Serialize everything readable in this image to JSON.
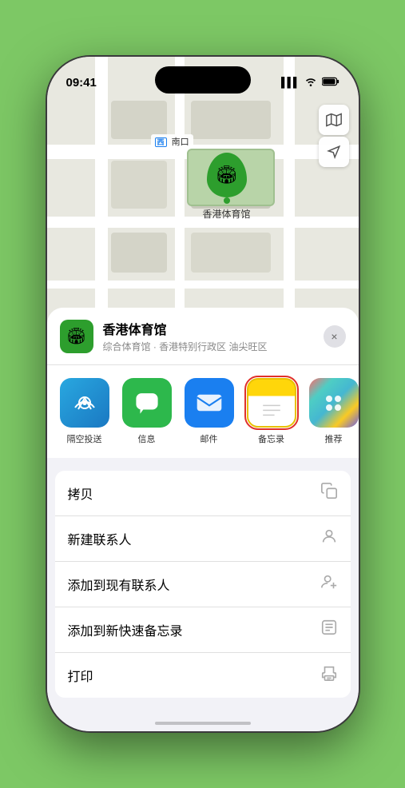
{
  "status_bar": {
    "time": "09:41",
    "signal_icon": "▌▌▌",
    "wifi_icon": "wifi",
    "battery_icon": "battery"
  },
  "map": {
    "south_label": "南口",
    "marker_label": "香港体育馆",
    "map_icon": "🗺",
    "location_icon": "➤"
  },
  "location_header": {
    "name": "香港体育馆",
    "subtitle": "综合体育馆 · 香港特别行政区 油尖旺区",
    "close_label": "×"
  },
  "share_items": [
    {
      "label": "隔空投送",
      "type": "airdrop"
    },
    {
      "label": "信息",
      "type": "message"
    },
    {
      "label": "邮件",
      "type": "mail"
    },
    {
      "label": "备忘录",
      "type": "notes",
      "selected": true
    }
  ],
  "actions": [
    {
      "label": "拷贝",
      "icon": "copy"
    },
    {
      "label": "新建联系人",
      "icon": "person"
    },
    {
      "label": "添加到现有联系人",
      "icon": "person-add"
    },
    {
      "label": "添加到新快速备忘录",
      "icon": "note"
    },
    {
      "label": "打印",
      "icon": "print"
    }
  ]
}
